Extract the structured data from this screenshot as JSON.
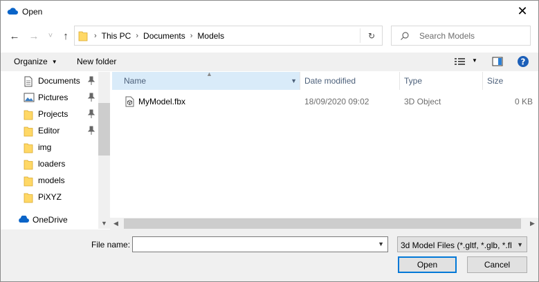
{
  "window": {
    "title": "Open",
    "close_glyph": "✕"
  },
  "nav_buttons": {
    "back": "←",
    "forward": "→",
    "recent": "˅",
    "up": "↑"
  },
  "address": {
    "crumbs": [
      "This PC",
      "Documents",
      "Models"
    ],
    "separator": "›",
    "refresh_glyph": "↻"
  },
  "search": {
    "placeholder": "Search Models"
  },
  "commands": {
    "organize": "Organize",
    "new_folder": "New folder",
    "caret": "▼"
  },
  "sidebar": {
    "items": [
      {
        "label": "Documents",
        "icon": "documents-icon",
        "pinned": true
      },
      {
        "label": "Pictures",
        "icon": "pictures-icon",
        "pinned": true
      },
      {
        "label": "Projects",
        "icon": "folder-icon",
        "pinned": true
      },
      {
        "label": "Editor",
        "icon": "folder-icon",
        "pinned": true
      },
      {
        "label": "img",
        "icon": "folder-icon",
        "pinned": false
      },
      {
        "label": "loaders",
        "icon": "folder-icon",
        "pinned": false
      },
      {
        "label": "models",
        "icon": "folder-icon",
        "pinned": false
      },
      {
        "label": "PiXYZ",
        "icon": "folder-icon",
        "pinned": false
      },
      {
        "label": "OneDrive",
        "icon": "onedrive-icon",
        "pinned": false
      }
    ]
  },
  "columns": {
    "name": "Name",
    "date": "Date modified",
    "type": "Type",
    "size": "Size"
  },
  "files": [
    {
      "name": "MyModel.fbx",
      "date": "18/09/2020 09:02",
      "type": "3D Object",
      "size": "0 KB"
    }
  ],
  "footer": {
    "file_name_label": "File name:",
    "file_name_value": "",
    "filter_value": "3d Model Files (*.gltf, *.glb, *.fb",
    "open_label": "Open",
    "cancel_label": "Cancel"
  },
  "colors": {
    "accent": "#0078d7",
    "header_selected": "#d9ebf9",
    "folder": "#ffd866"
  }
}
